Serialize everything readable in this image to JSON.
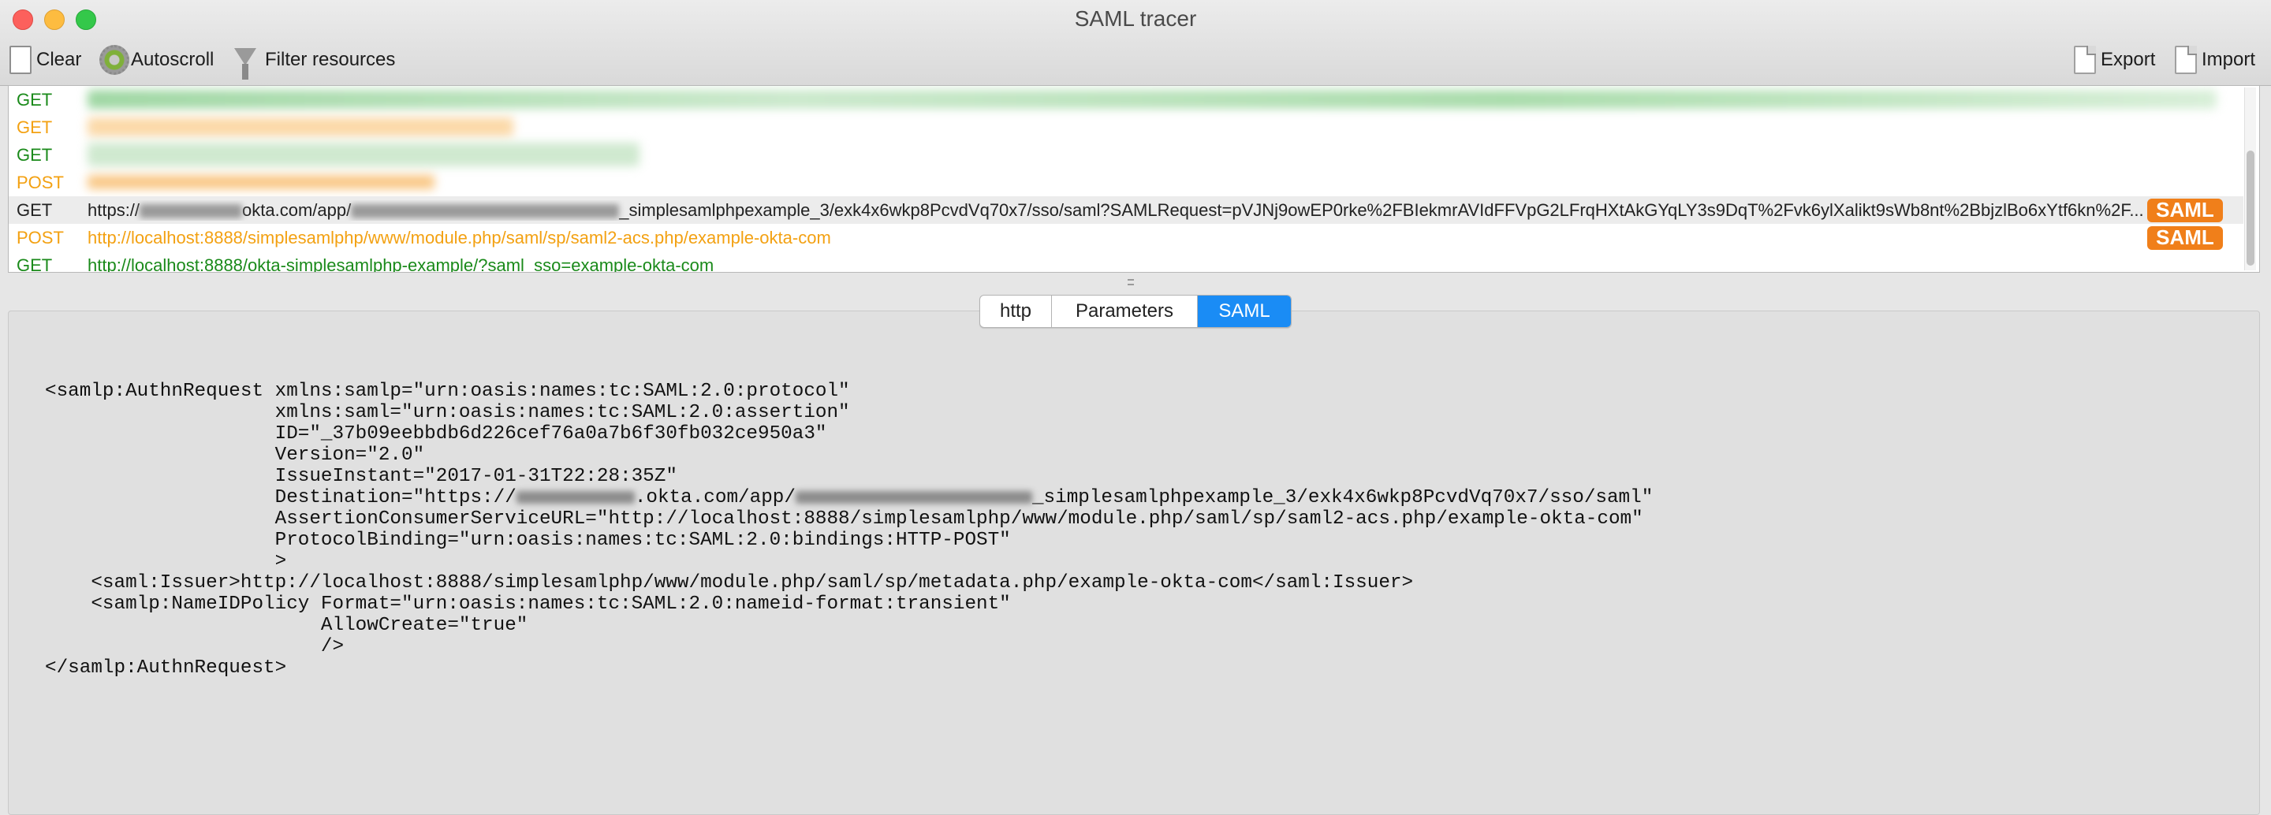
{
  "window": {
    "title": "SAML tracer"
  },
  "toolbar": {
    "clear_label": "Clear",
    "autoscroll_label": "Autoscroll",
    "filter_label": "Filter resources",
    "export_label": "Export",
    "import_label": "Import"
  },
  "requests": [
    {
      "method": "GET",
      "url": "",
      "saml": false,
      "redacted": true
    },
    {
      "method": "GET",
      "url": "",
      "saml": false,
      "redacted": true
    },
    {
      "method": "GET",
      "url": "",
      "saml": false,
      "redacted": true
    },
    {
      "method": "POST",
      "url": "",
      "saml": false,
      "redacted": true
    },
    {
      "method": "GET",
      "url_prefix": "https://",
      "url_mid": "okta.com/app/",
      "url_suffix": "_simplesamlphpexample_3/exk4x6wkp8PcvdVq70x7/sso/saml?SAMLRequest=pVJNj9owEP0rke%2FBIekmrAVIdFFVpG2LFrqHXtAkGYqLY3s9DqT%2Fvk6ylXalikt9sWb8nt%2BbjzlBo6xYtf6kn%2F...",
      "saml": true,
      "selected": true
    },
    {
      "method": "POST",
      "url": "http://localhost:8888/simplesamlphp/www/module.php/saml/sp/saml2-acs.php/example-okta-com",
      "saml": true
    },
    {
      "method": "GET",
      "url": "http://localhost:8888/okta-simplesamlphp-example/?saml_sso=example-okta-com",
      "saml": false
    }
  ],
  "saml_badge": "SAML",
  "tabs": {
    "http": "http",
    "parameters": "Parameters",
    "saml": "SAML",
    "active": "SAML"
  },
  "xml": {
    "l1": "<samlp:AuthnRequest xmlns:samlp=\"urn:oasis:names:tc:SAML:2.0:protocol\"",
    "l2": "                    xmlns:saml=\"urn:oasis:names:tc:SAML:2.0:assertion\"",
    "l3": "                    ID=\"_37b09eebbdb6d226cef76a0a7b6f30fb032ce950a3\"",
    "l4": "                    Version=\"2.0\"",
    "l5": "                    IssueInstant=\"2017-01-31T22:28:35Z\"",
    "l6_prefix": "                    Destination=\"https://",
    "l6_mid": ".okta.com/app/",
    "l6_suffix": "_simplesamlphpexample_3/exk4x6wkp8PcvdVq70x7/sso/saml\"",
    "l7": "                    AssertionConsumerServiceURL=\"http://localhost:8888/simplesamlphp/www/module.php/saml/sp/saml2-acs.php/example-okta-com\"",
    "l8": "                    ProtocolBinding=\"urn:oasis:names:tc:SAML:2.0:bindings:HTTP-POST\"",
    "l9": "                    >",
    "l10": "    <saml:Issuer>http://localhost:8888/simplesamlphp/www/module.php/saml/sp/metadata.php/example-okta-com</saml:Issuer>",
    "l11": "    <samlp:NameIDPolicy Format=\"urn:oasis:names:tc:SAML:2.0:nameid-format:transient\"",
    "l12": "                        AllowCreate=\"true\"",
    "l13": "                        />",
    "l14": "</samlp:AuthnRequest>"
  },
  "colors": {
    "get": "#1a8a1a",
    "post": "#f3a112",
    "saml_badge": "#f07f1a",
    "active_tab": "#1a8cf5"
  }
}
